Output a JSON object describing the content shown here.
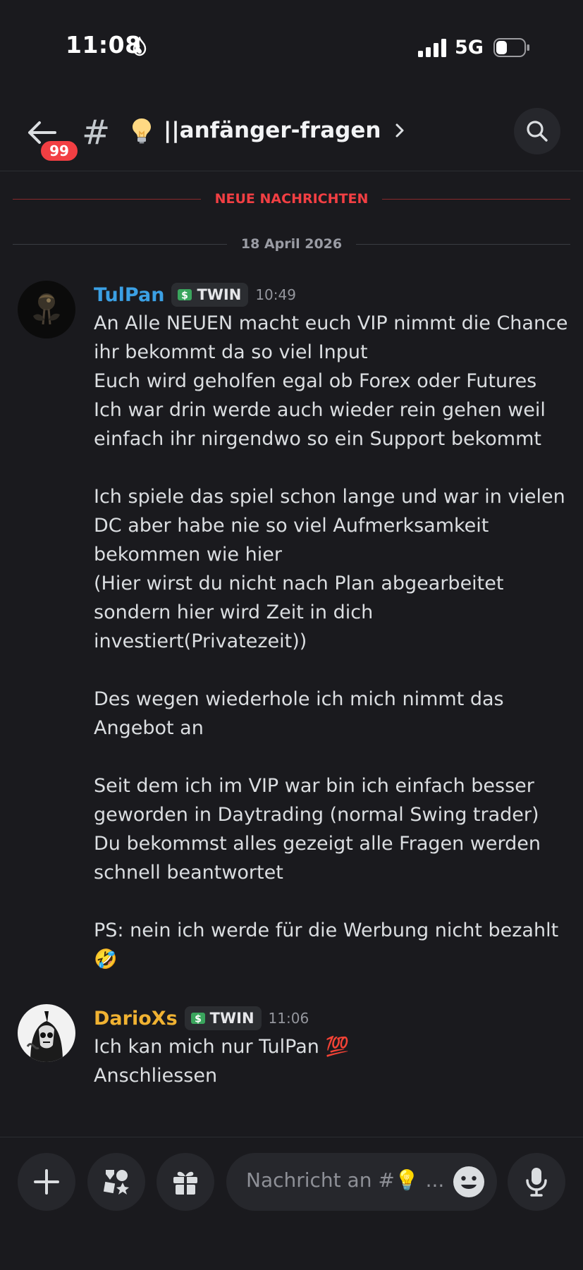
{
  "status_bar": {
    "time": "11:08",
    "network": "5G"
  },
  "header": {
    "unread_badge": "99",
    "channel_icon": "#",
    "channel_name": "||anfänger-fragen"
  },
  "dividers": {
    "new_messages": "NEUE NACHRICHTEN",
    "date": "18 April 2026"
  },
  "messages": [
    {
      "author": "TulPan",
      "author_color": "#3ba0e4",
      "tag": "TWIN",
      "timestamp": "10:49",
      "paragraphs": [
        [
          "An Alle NEUEN macht euch VIP nimmt die Chance",
          "ihr bekommt da so viel Input",
          "Euch wird geholfen egal ob Forex oder Futures",
          "Ich war drin werde auch wieder rein gehen weil",
          "einfach ihr nirgendwo so ein Support bekommt"
        ],
        [
          "Ich spiele das spiel schon lange und war in vielen",
          "DC aber habe nie so viel Aufmerksamkeit",
          "bekommen wie hier",
          "(Hier wirst du nicht nach Plan abgearbeitet",
          "sondern hier wird Zeit in dich",
          "investiert(Privatezeit))"
        ],
        [
          "Des wegen wiederhole ich mich nimmt das",
          "Angebot an"
        ],
        [
          "Seit dem ich im VIP war bin ich einfach besser",
          "geworden in Daytrading (normal Swing trader)",
          "Du bekommst alles gezeigt alle Fragen werden",
          "schnell beantwortet"
        ],
        [
          "PS: nein ich werde für die Werbung nicht bezahlt",
          "🤣"
        ]
      ]
    },
    {
      "author": "DarioXs",
      "author_color": "#f0b232",
      "tag": "TWIN",
      "timestamp": "11:06",
      "lines": [
        "Ich kan mich nur TulPan 💯",
        "Anschliessen"
      ]
    }
  ],
  "composer": {
    "placeholder": "Nachricht an #💡 ..."
  },
  "icons": {
    "status": [
      "flame-icon",
      "signal-icon",
      "battery-icon"
    ],
    "header": [
      "back-arrow-icon",
      "hash-icon",
      "lightbulb-icon",
      "chevron-right-icon",
      "search-icon"
    ],
    "composer": [
      "plus-icon",
      "apps-icon",
      "gift-icon",
      "emoji-icon",
      "microphone-icon"
    ]
  }
}
